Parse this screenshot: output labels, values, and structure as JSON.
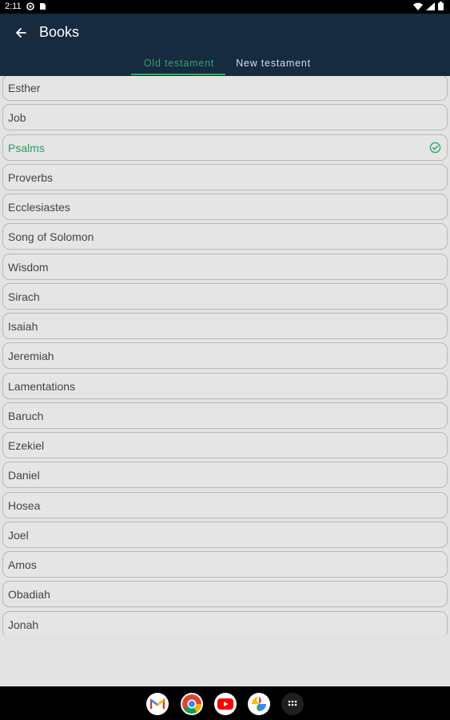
{
  "status_bar": {
    "time": "2:11"
  },
  "app_bar": {
    "title": "Books"
  },
  "tabs": [
    {
      "label": "Old testament",
      "selected": true
    },
    {
      "label": "New testament",
      "selected": false
    }
  ],
  "books": [
    {
      "name": "Esther"
    },
    {
      "name": "Job"
    },
    {
      "name": "Psalms",
      "selected": true
    },
    {
      "name": "Proverbs"
    },
    {
      "name": "Ecclesiastes"
    },
    {
      "name": "Song of Solomon"
    },
    {
      "name": "Wisdom"
    },
    {
      "name": "Sirach"
    },
    {
      "name": "Isaiah"
    },
    {
      "name": "Jeremiah"
    },
    {
      "name": "Lamentations"
    },
    {
      "name": "Baruch"
    },
    {
      "name": "Ezekiel"
    },
    {
      "name": "Daniel"
    },
    {
      "name": "Hosea"
    },
    {
      "name": "Joel"
    },
    {
      "name": "Amos"
    },
    {
      "name": "Obadiah"
    },
    {
      "name": "Jonah"
    }
  ],
  "colors": {
    "accent": "#2ea86a",
    "app_bar": "#162a40"
  },
  "nav_apps": [
    "gmail-icon",
    "chrome-icon",
    "youtube-icon",
    "photos-icon",
    "app-drawer-icon"
  ]
}
